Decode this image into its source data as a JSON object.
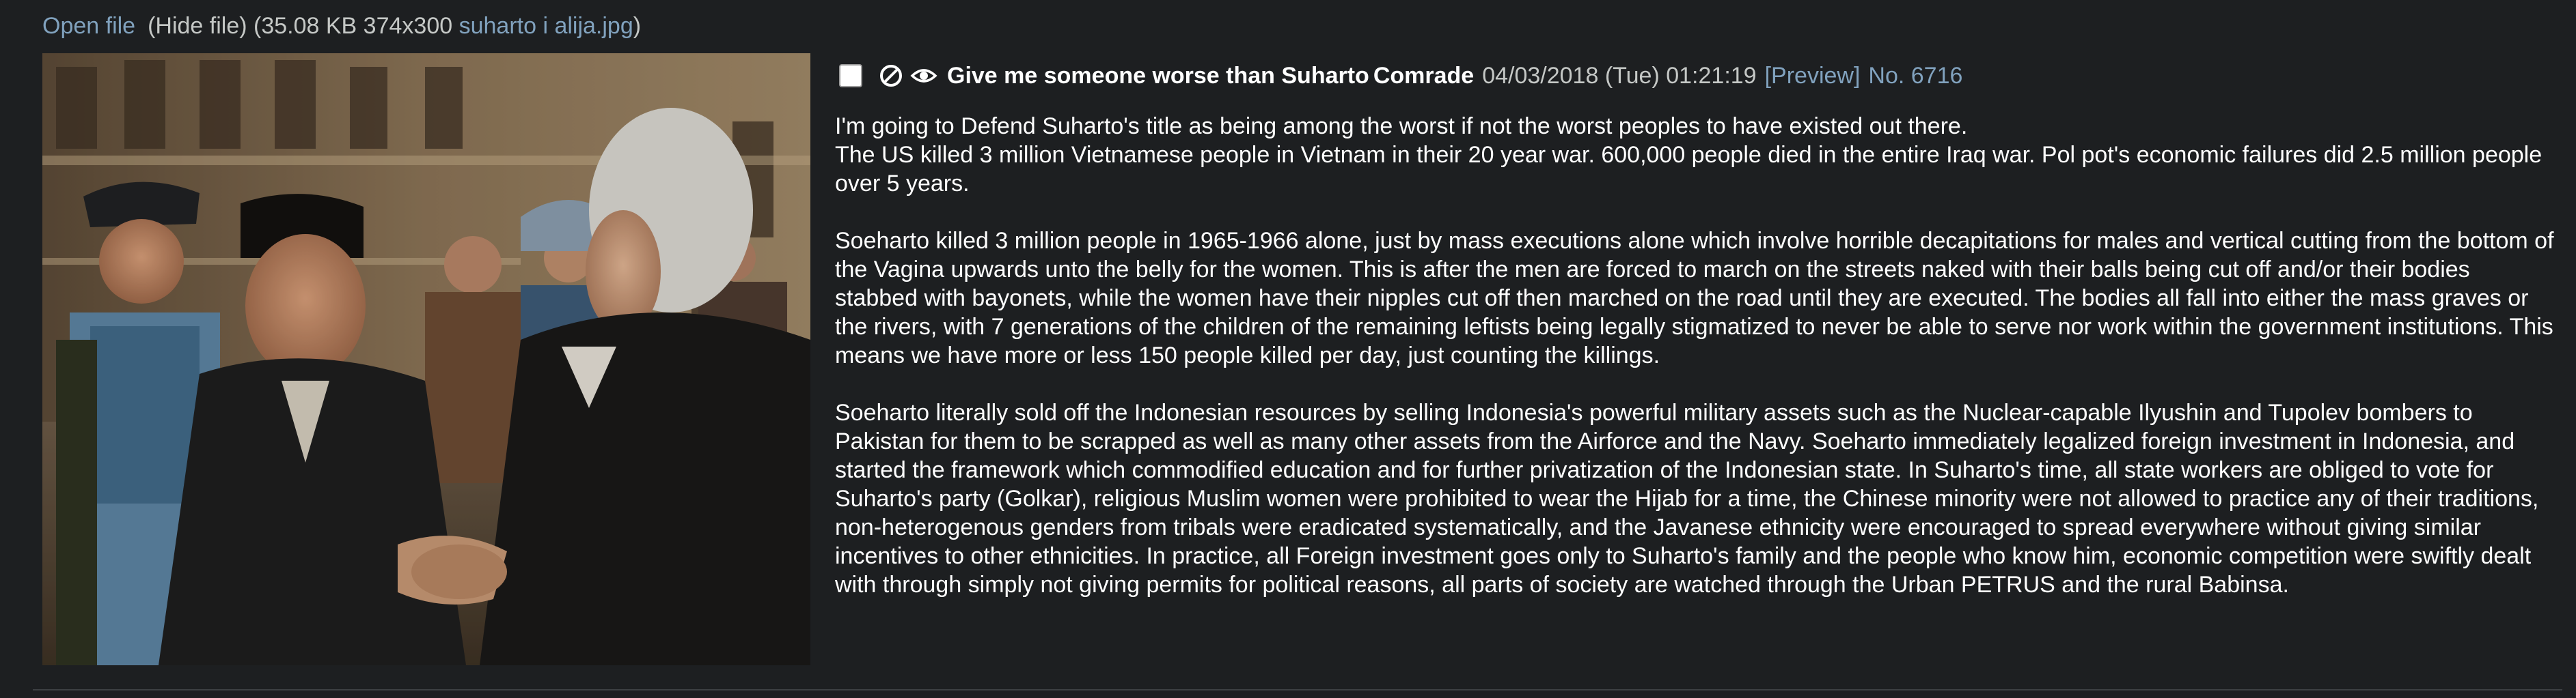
{
  "file_info": {
    "open_label": "Open file",
    "hide_label": "(Hide file)",
    "meta": "(35.08 KB 374x300",
    "filename": "suharto i alija.jpg",
    "close_paren": ")"
  },
  "post": {
    "subject": "Give me someone worse than Suharto",
    "name": "Comrade",
    "date": "04/03/2018 (Tue) 01:21:19",
    "preview_label": "[Preview]",
    "number_label": "No. 6716",
    "icons": [
      "hide-icon",
      "watch-icon"
    ],
    "paragraphs": [
      "I'm going to Defend Suharto's title as being among the worst if not the worst peoples to have existed out there.\nThe US killed 3 million Vietnamese people in Vietnam in their 20 year war. 600,000 people died in the entire Iraq war. Pol pot's economic failures did 2.5 million people over 5 years.",
      "Soeharto killed 3 million people in 1965-1966 alone, just by mass executions alone which involve horrible decapitations for males and vertical cutting from the bottom of the Vagina upwards unto the belly for the women. This is after the men are forced to march on the streets naked with their balls being cut off and/or their bodies stabbed with bayonets, while the women have their nipples cut off then marched on the road until they are executed. The bodies all fall into either the mass graves or the rivers, with 7 generations of the children of the remaining leftists being legally stigmatized to never be able to serve nor work within the government institutions. This means we have more or less 150 people killed per day, just counting the killings.",
      "Soeharto literally sold off the Indonesian resources by selling Indonesia's powerful military assets such as the Nuclear-capable Ilyushin and Tupolev bombers to Pakistan for them to be scrapped as well as many other assets from the Airforce and the Navy. Soeharto immediately legalized foreign investment in Indonesia, and started the framework which commodified education and for further privatization of the Indonesian state. In Suharto's time, all state workers are obliged to vote for Suharto's party (Golkar), religious Muslim women were prohibited to wear the Hijab for a time, the Chinese minority were not allowed to practice any of their traditions, non-heterogenous genders from tribals were eradicated systematically, and the Javanese ethnicity were encouraged to spread everywhere without giving similar incentives to other ethnicities. In practice, all Foreign investment goes only to Suharto's family and the people who know him, economic competition were swiftly dealt with through simply not giving permits for political reasons, all parts of society are watched through the Urban PETRUS and the rural Babinsa."
    ]
  },
  "colors": {
    "background": "#1d1f21",
    "text": "#c5c8c6",
    "link": "#81a2be",
    "body_text": "#ffffff"
  }
}
